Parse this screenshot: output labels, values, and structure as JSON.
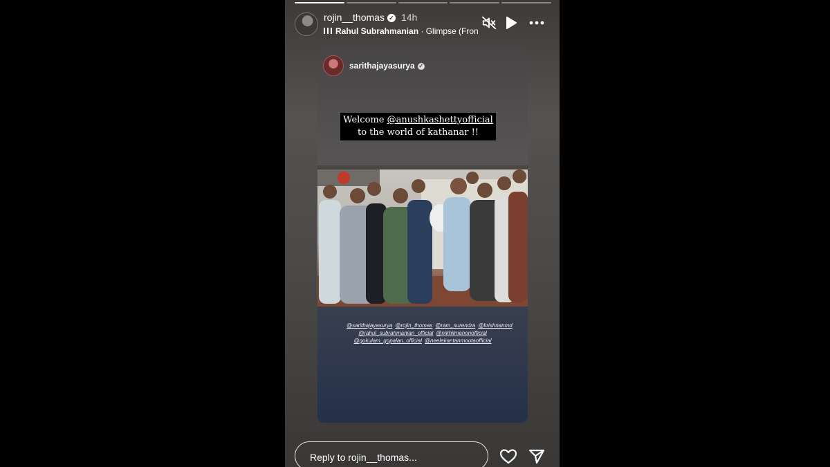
{
  "story": {
    "username": "rojin__thomas",
    "time": "14h",
    "music_artist": "Rahul Subrahmanian",
    "music_track": "Glimpse (Fron",
    "segments_total": 5,
    "segments_done": 1
  },
  "shared_post": {
    "username": "sarithajayasurya",
    "caption_line1_prefix": "Welcome ",
    "caption_mention": "@anushkashettyofficial",
    "caption_line2": "to the world of kathanar !!",
    "tags": [
      "@sarithajayasurya",
      "@rojin_thomas",
      "@ram_surendra",
      "@krishnanmd",
      "@rahul_subrahmanian_official",
      "@nikhilmenonofficial",
      "@gokulam_gopalan_official",
      "@neelakantanmootaofficial"
    ]
  },
  "reply": {
    "placeholder": "Reply to rojin__thomas..."
  },
  "icons": [
    "mute-icon",
    "play-icon",
    "more-icon",
    "heart-icon",
    "send-icon"
  ]
}
